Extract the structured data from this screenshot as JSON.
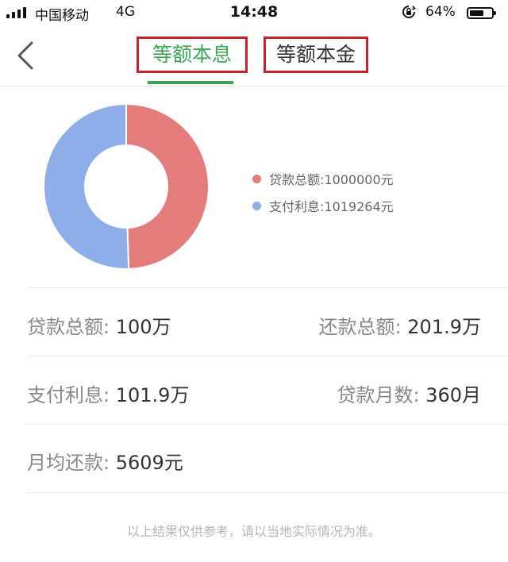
{
  "status_bar": {
    "carrier": "中国移动",
    "network": "4G",
    "time": "14:48",
    "battery": "64%",
    "battery_level": 0.64
  },
  "nav": {
    "tabs": [
      {
        "label": "等额本息",
        "active": true
      },
      {
        "label": "等额本金",
        "active": false
      }
    ],
    "accent_color": "#3aa655",
    "highlight_box_color": "#c8232c"
  },
  "chart_data": {
    "type": "pie",
    "donut": true,
    "slices": [
      {
        "name": "贷款总额",
        "value": 1000000,
        "color": "#e57c7c"
      },
      {
        "name": "支付利息",
        "value": 1019264,
        "color": "#8eaeea"
      }
    ],
    "legend": [
      "贷款总额:1000000元",
      "支付利息:1019264元"
    ],
    "legend_placement": "right"
  },
  "stats": {
    "loan_total": {
      "label": "贷款总额:",
      "value": "100万"
    },
    "repay_total": {
      "label": "还款总额:",
      "value": "201.9万"
    },
    "interest": {
      "label": "支付利息:",
      "value": "101.9万"
    },
    "months": {
      "label": "贷款月数:",
      "value": "360月"
    },
    "monthly": {
      "label": "月均还款:",
      "value": "5609元"
    }
  },
  "footnote": "以上结果仅供参考，请以当地实际情况为准。"
}
